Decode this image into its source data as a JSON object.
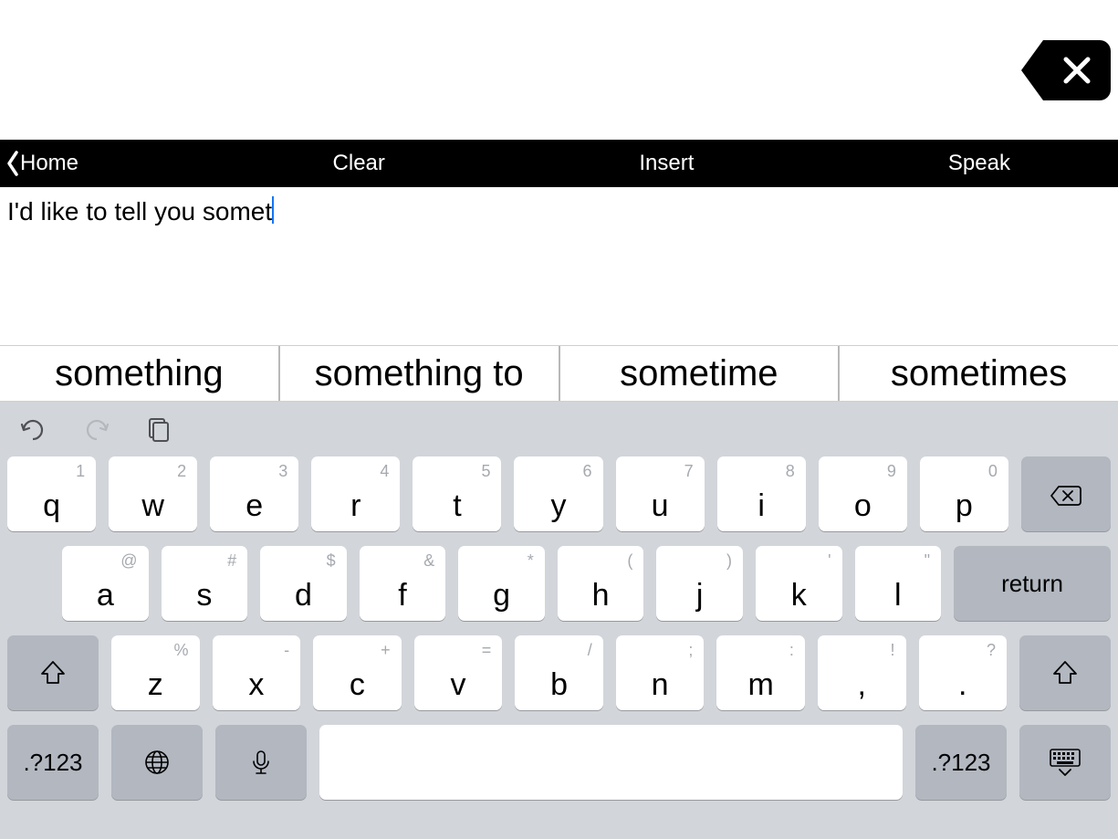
{
  "toolbar": {
    "back_label": "Home",
    "clear_label": "Clear",
    "insert_label": "Insert",
    "speak_label": "Speak"
  },
  "text": {
    "content": "I'd like to tell you somet"
  },
  "suggestions": [
    "something",
    "something to",
    "sometime",
    "sometimes"
  ],
  "keyboard": {
    "row1": [
      {
        "main": "q",
        "alt": "1"
      },
      {
        "main": "w",
        "alt": "2"
      },
      {
        "main": "e",
        "alt": "3"
      },
      {
        "main": "r",
        "alt": "4"
      },
      {
        "main": "t",
        "alt": "5"
      },
      {
        "main": "y",
        "alt": "6"
      },
      {
        "main": "u",
        "alt": "7"
      },
      {
        "main": "i",
        "alt": "8"
      },
      {
        "main": "o",
        "alt": "9"
      },
      {
        "main": "p",
        "alt": "0"
      }
    ],
    "row2": [
      {
        "main": "a",
        "alt": "@"
      },
      {
        "main": "s",
        "alt": "#"
      },
      {
        "main": "d",
        "alt": "$"
      },
      {
        "main": "f",
        "alt": "&"
      },
      {
        "main": "g",
        "alt": "*"
      },
      {
        "main": "h",
        "alt": "("
      },
      {
        "main": "j",
        "alt": ")"
      },
      {
        "main": "k",
        "alt": "'"
      },
      {
        "main": "l",
        "alt": "\""
      }
    ],
    "return_label": "return",
    "row3": [
      {
        "main": "z",
        "alt": "%"
      },
      {
        "main": "x",
        "alt": "-"
      },
      {
        "main": "c",
        "alt": "+"
      },
      {
        "main": "v",
        "alt": "="
      },
      {
        "main": "b",
        "alt": "/"
      },
      {
        "main": "n",
        "alt": ";"
      },
      {
        "main": "m",
        "alt": ":"
      },
      {
        "main": ",",
        "alt": "!"
      },
      {
        "main": ".",
        "alt": "?"
      }
    ],
    "numkey_label": ".?123"
  }
}
